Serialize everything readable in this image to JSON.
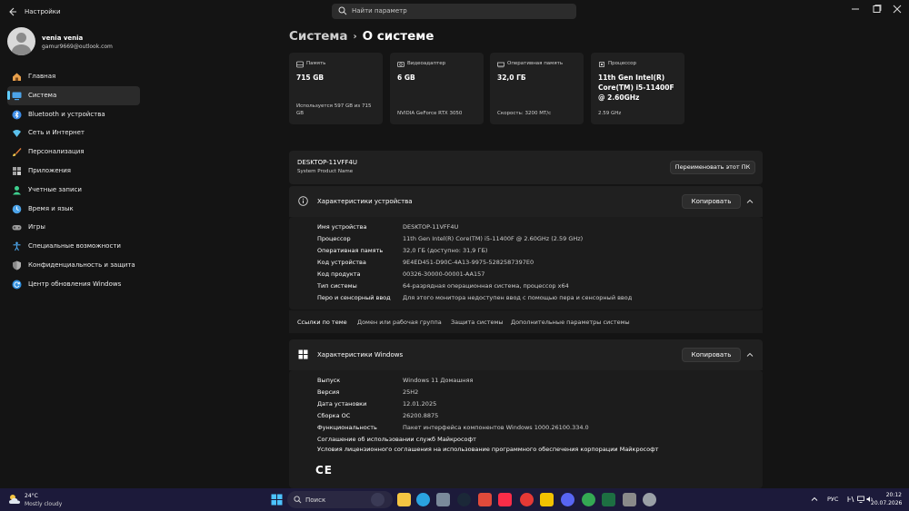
{
  "titlebar": {
    "title": "Настройки",
    "search_placeholder": "Найти параметр"
  },
  "user": {
    "name": "venia venia",
    "email": "gamur9669@outlook.com"
  },
  "sidebar": {
    "items": [
      {
        "label": "Главная",
        "icon": "home-icon",
        "color": "#e8a04c"
      },
      {
        "label": "Система",
        "icon": "system-icon",
        "color": "#4ca3e8"
      },
      {
        "label": "Bluetooth и устройства",
        "icon": "bluetooth-icon",
        "color": "#3c8ce7"
      },
      {
        "label": "Сеть и Интернет",
        "icon": "network-icon",
        "color": "#5bc0eb"
      },
      {
        "label": "Персонализация",
        "icon": "brush-icon",
        "color": "#e07b39"
      },
      {
        "label": "Приложения",
        "icon": "apps-icon",
        "color": "#a0a0a0"
      },
      {
        "label": "Учетные записи",
        "icon": "account-icon",
        "color": "#3ecf8e"
      },
      {
        "label": "Время и язык",
        "icon": "globe-clock-icon",
        "color": "#4ca3e8"
      },
      {
        "label": "Игры",
        "icon": "gamepad-icon",
        "color": "#9a9a9a"
      },
      {
        "label": "Специальные возможности",
        "icon": "accessibility-icon",
        "color": "#4ca3e8"
      },
      {
        "label": "Конфиденциальность и защита",
        "icon": "shield-icon",
        "color": "#8a8a8a"
      },
      {
        "label": "Центр обновления Windows",
        "icon": "update-icon",
        "color": "#2f8fe0"
      }
    ]
  },
  "breadcrumb": {
    "parent": "Система",
    "separator": "›",
    "current": "О системе"
  },
  "cards": [
    {
      "title": "Память",
      "value": "715 GB",
      "sub": "Используется 597 GB из 715 GB",
      "icon": "storage-icon"
    },
    {
      "title": "Видеоадаптер",
      "value": "6 GB",
      "sub": "NVIDIA GeForce RTX 3050",
      "icon": "gpu-icon"
    },
    {
      "title": "Оперативная память",
      "value": "32,0 ГБ",
      "sub": "Скорость: 3200 МТ/с",
      "icon": "ram-icon"
    },
    {
      "title": "Процессор",
      "value": "11th Gen Intel(R) Core(TM) i5-11400F @ 2.60GHz",
      "sub": "2.59 GHz",
      "icon": "cpu-icon"
    }
  ],
  "pc": {
    "name": "DESKTOP-11VFF4U",
    "sub": "System Product Name",
    "rename_label": "Переименовать этот ПК"
  },
  "device_specs": {
    "title": "Характеристики устройства",
    "copy_label": "Копировать",
    "rows": [
      {
        "label": "Имя устройства",
        "value": "DESKTOP-11VFF4U"
      },
      {
        "label": "Процессор",
        "value": "11th Gen Intel(R) Core(TM) i5-11400F @ 2.60GHz (2.59 GHz)"
      },
      {
        "label": "Оперативная память",
        "value": "32,0 ГБ (доступно: 31,9 ГБ)"
      },
      {
        "label": "Код устройства",
        "value": "9E4ED451-D90C-4A13-9975-5282587397E0"
      },
      {
        "label": "Код продукта",
        "value": "00326-30000-00001-AA157"
      },
      {
        "label": "Тип системы",
        "value": "64-разрядная операционная система, процессор x64"
      },
      {
        "label": "Перо и сенсорный ввод",
        "value": "Для этого монитора недоступен ввод с помощью пера и сенсорный ввод"
      }
    ]
  },
  "related_links": {
    "title": "Ссылки по теме",
    "items": [
      "Домен или рабочая группа",
      "Защита системы",
      "Дополнительные параметры системы"
    ]
  },
  "windows_specs": {
    "title": "Характеристики Windows",
    "copy_label": "Копировать",
    "rows": [
      {
        "label": "Выпуск",
        "value": "Windows 11 Домашняя"
      },
      {
        "label": "Версия",
        "value": "25H2"
      },
      {
        "label": "Дата установки",
        "value": "12.01.2025"
      },
      {
        "label": "Сборка ОС",
        "value": "26200.8875"
      },
      {
        "label": "Функциональность",
        "value": "Пакет интерфейса компонентов Windows 1000.26100.334.0"
      }
    ],
    "links": [
      "Соглашение об использовании служб Майкрософт",
      "Условия лицензионного соглашения на использование программного обеспечения корпорации Майкрософт"
    ],
    "ce_mark": "CE"
  },
  "taskbar": {
    "weather_temp": "24°C",
    "weather_desc": "Mostly cloudy",
    "search_placeholder": "Поиск",
    "lang": "РУС",
    "time": "20:12",
    "date": "20.07.2026",
    "apps": [
      {
        "icon": "start-icon",
        "color": "#4cc2ff"
      },
      {
        "icon": "file-explorer-icon",
        "color": "#f5c542"
      },
      {
        "icon": "telegram-icon",
        "color": "#2aa3e0"
      },
      {
        "icon": "grid-app-icon",
        "color": "#7a8a9a"
      },
      {
        "icon": "steam-icon",
        "color": "#1b2838"
      },
      {
        "icon": "colorful-app-icon",
        "color": "#e04a3a"
      },
      {
        "icon": "music-icon",
        "color": "#fa2d48"
      },
      {
        "icon": "red-app-icon",
        "color": "#e53935"
      },
      {
        "icon": "yellow-app-icon",
        "color": "#f2c200"
      },
      {
        "icon": "discord-icon",
        "color": "#5865f2"
      },
      {
        "icon": "chrome-icon",
        "color": "#34a853"
      },
      {
        "icon": "excel-icon",
        "color": "#1d6f42"
      },
      {
        "icon": "store-icon",
        "color": "#8a8a8a"
      },
      {
        "icon": "settings-icon",
        "color": "#9aa0a6"
      }
    ]
  }
}
